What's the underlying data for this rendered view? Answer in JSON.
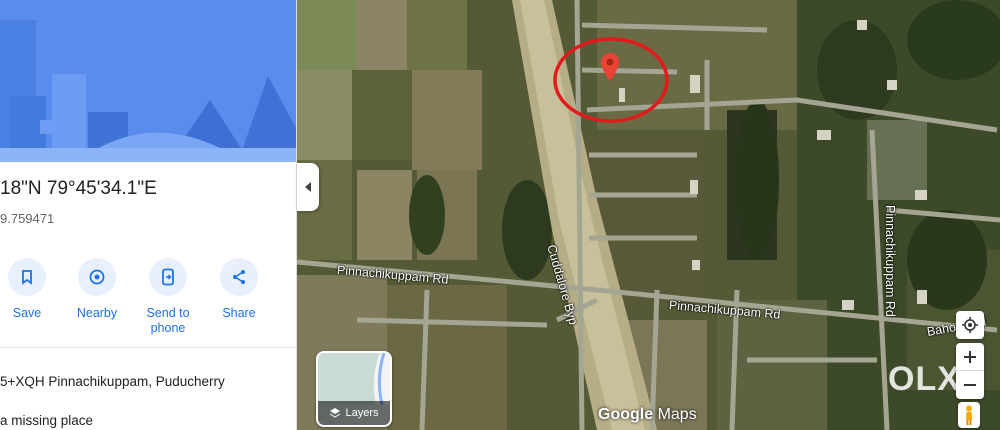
{
  "place": {
    "coordinates": "18\"N 79°45'34.1\"E",
    "decimal": "9.759471",
    "plus_code": "5+XQH Pinnachikuppam, Puducherry",
    "missing_place": "a missing place"
  },
  "actions": [
    {
      "label": "Save",
      "icon": "bookmark-icon"
    },
    {
      "label": "Nearby",
      "icon": "nearby-icon"
    },
    {
      "label": "Send to phone",
      "label_line1": "Send to",
      "label_line2": "phone",
      "icon": "send-to-phone-icon"
    },
    {
      "label": "Share",
      "icon": "share-icon"
    }
  ],
  "map": {
    "roads": {
      "pinnachikuppam_left": "Pinnachikuppam Rd",
      "cuddalore_byp": "Cuddalore Byp",
      "pinnachikuppam_center": "Pinnachikuppam Rd",
      "pinnachikuppam_vertical": "Pinnachikuppam Rd",
      "bahour": "Bahour Rd"
    },
    "layers_label": "Layers",
    "brand_google": "Google",
    "brand_maps": "Maps",
    "watermark": "OLX",
    "colors": {
      "pin": "#ea4335",
      "circle": "#e3191c",
      "accent": "#1a73e8",
      "hero": "#4f84e9"
    }
  }
}
